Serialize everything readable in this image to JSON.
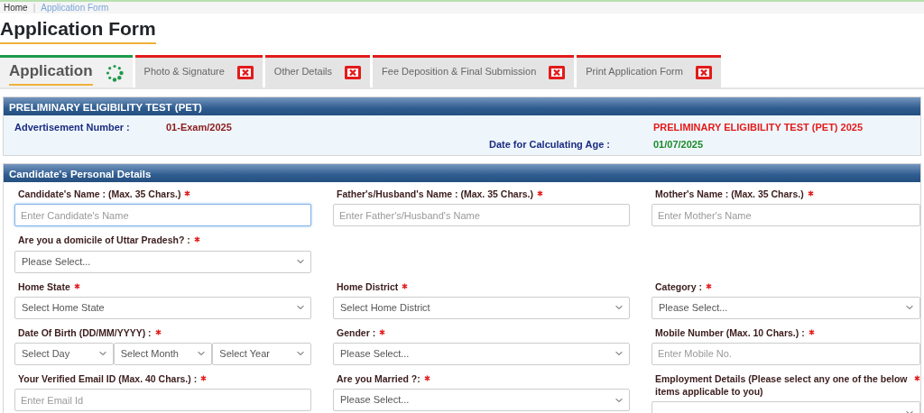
{
  "breadcrumb_separator": "|",
  "breadcrumb": [
    {
      "label": "Home",
      "selected": false
    },
    {
      "label": "Application Form",
      "selected": true
    }
  ],
  "page_title": "Application Form",
  "tabs": [
    {
      "label": "Application",
      "selected": true,
      "kind": "in_progress"
    },
    {
      "label": "Photo & Signature",
      "selected": false,
      "kind": "incomplete"
    },
    {
      "label": "Other Details",
      "selected": false,
      "kind": "incomplete"
    },
    {
      "label": "Fee Deposition & Final Submission",
      "selected": false,
      "kind": "incomplete"
    },
    {
      "label": "Print Application Form",
      "selected": false,
      "kind": "incomplete"
    }
  ],
  "exam_panel": {
    "title": "PRELIMINARY ELIGIBILITY TEST (PET)",
    "advertisement_label": "Advertisement Number :",
    "advertisement_value": "01-Exam/2025",
    "exam_name": "PRELIMINARY ELIGIBILITY TEST (PET) 2025",
    "age_date_label": "Date for Calculating Age :",
    "age_date_value": "01/07/2025"
  },
  "personal_details": {
    "title": "Candidate's Personal Details",
    "fields": [
      {
        "label": "Candidate's Name : (Max. 35 Chars.)",
        "required": true,
        "kind": "text",
        "placeholder": "Enter Candidate's Name",
        "focused": true
      },
      {
        "label": "Father's/Husband's Name : (Max. 35 Chars.)",
        "required": true,
        "kind": "text",
        "placeholder": "Enter Father's/Husband's Name",
        "focused": false
      },
      {
        "label": "Mother's Name : (Max. 35 Chars.)",
        "required": true,
        "kind": "text",
        "placeholder": "Enter Mother's Name",
        "focused": false
      },
      {
        "label": "Are you a domicile of Uttar Pradesh? :",
        "required": true,
        "kind": "select",
        "value": "Please Select...",
        "focused": false
      },
      {
        "kind": "blank"
      },
      {
        "kind": "blank"
      },
      {
        "label": "Home State",
        "required": true,
        "kind": "select",
        "value": "Select Home State",
        "focused": false
      },
      {
        "label": "Home District",
        "required": true,
        "kind": "select",
        "value": "Select Home District",
        "focused": false
      },
      {
        "label": "Category :",
        "required": true,
        "kind": "select",
        "value": "Please Select...",
        "focused": false
      },
      {
        "label": "Date Of Birth (DD/MM/YYYY) :",
        "required": true,
        "kind": "date",
        "parts": [
          "Select Day",
          "Select Month",
          "Select Year"
        ],
        "focused": false
      },
      {
        "label": "Gender :",
        "required": true,
        "kind": "select",
        "value": "Please Select...",
        "focused": false
      },
      {
        "label": "Mobile Number (Max. 10 Chars.) :",
        "required": true,
        "kind": "text",
        "placeholder": "Enter Mobile No.",
        "focused": false
      },
      {
        "label": "Your Verified Email ID (Max. 40 Chars.) :",
        "required": true,
        "kind": "text",
        "placeholder": "Enter Email Id",
        "focused": false
      },
      {
        "label": "Are you Married ?:",
        "required": true,
        "kind": "select",
        "value": "Please Select...",
        "focused": false
      },
      {
        "label": "Employment Details (Please select any one of the below items applicable to you)",
        "required": true,
        "kind": "select",
        "focused": false
      }
    ]
  }
}
